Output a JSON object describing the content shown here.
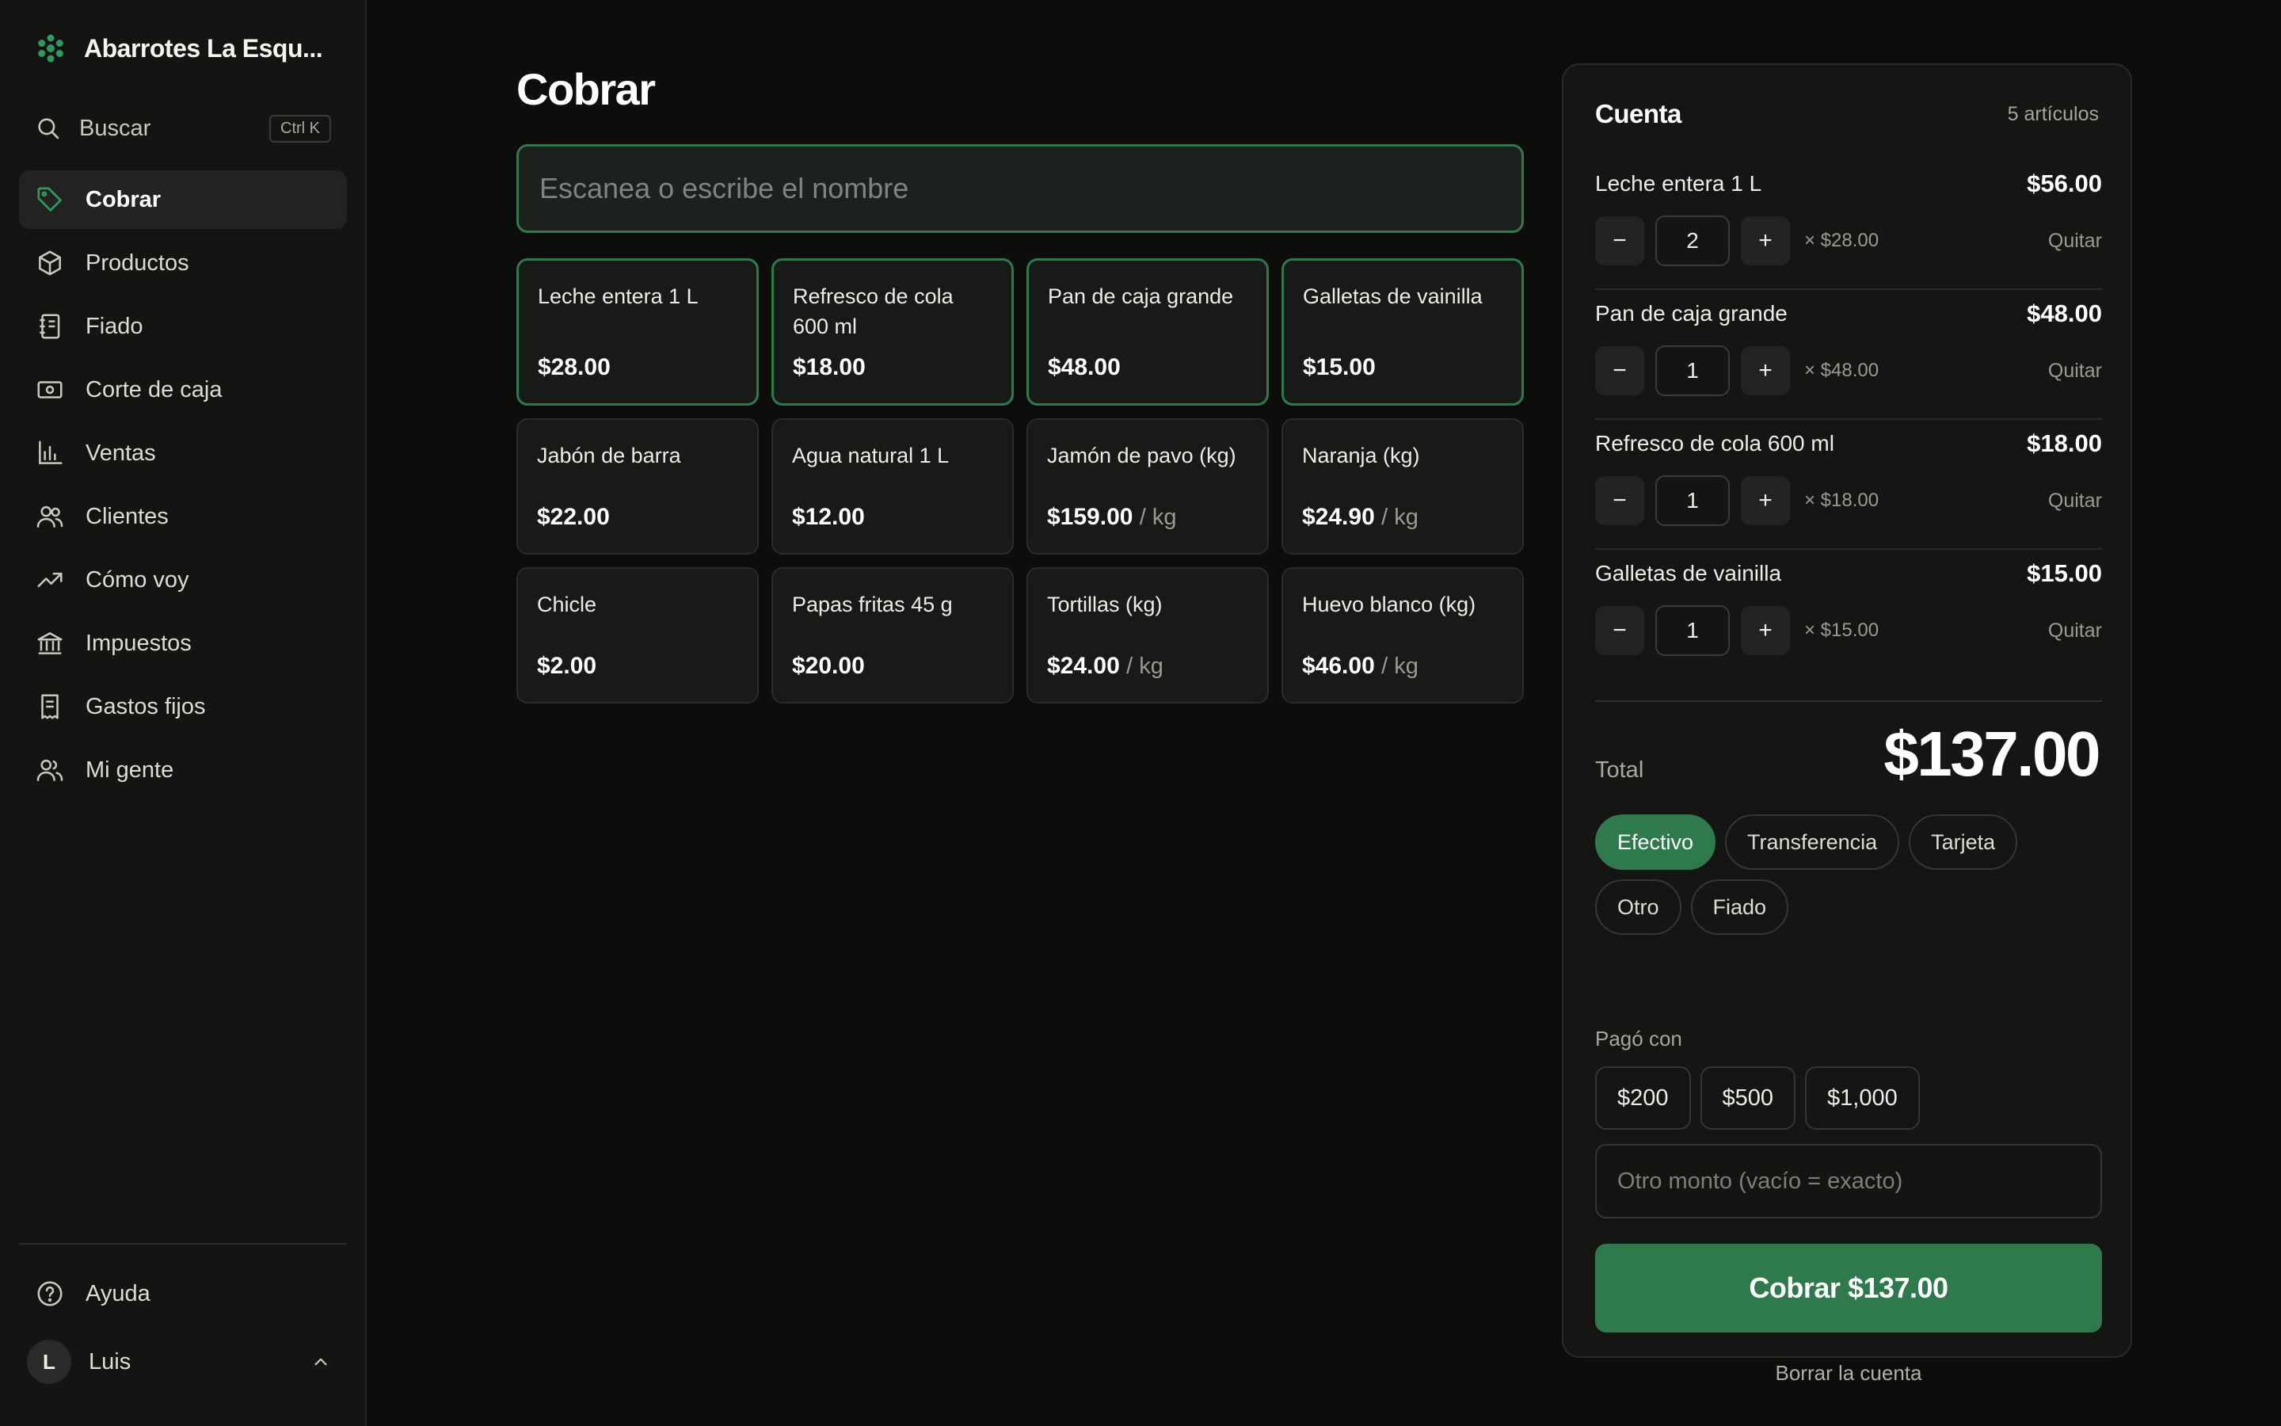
{
  "brand": {
    "name": "Abarrotes La Esqu..."
  },
  "search": {
    "label": "Buscar",
    "shortcut": "Ctrl K"
  },
  "nav": [
    {
      "label": "Cobrar",
      "icon": "tag-icon",
      "active": true
    },
    {
      "label": "Productos",
      "icon": "box-icon"
    },
    {
      "label": "Fiado",
      "icon": "notebook-icon"
    },
    {
      "label": "Corte de caja",
      "icon": "cash-icon"
    },
    {
      "label": "Ventas",
      "icon": "bar-chart-icon"
    },
    {
      "label": "Clientes",
      "icon": "users-icon"
    },
    {
      "label": "Cómo voy",
      "icon": "trend-up-icon"
    },
    {
      "label": "Impuestos",
      "icon": "bank-icon"
    },
    {
      "label": "Gastos fijos",
      "icon": "receipt-icon"
    },
    {
      "label": "Mi gente",
      "icon": "team-icon"
    }
  ],
  "help": {
    "label": "Ayuda"
  },
  "user": {
    "initial": "L",
    "name": "Luis"
  },
  "page": {
    "title": "Cobrar",
    "scan_placeholder": "Escanea o escribe el nombre"
  },
  "products": [
    {
      "name": "Leche entera 1 L",
      "price": "$28.00",
      "unit": "",
      "in_cart": true
    },
    {
      "name": "Refresco de cola 600 ml",
      "price": "$18.00",
      "unit": "",
      "in_cart": true
    },
    {
      "name": "Pan de caja grande",
      "price": "$48.00",
      "unit": "",
      "in_cart": true
    },
    {
      "name": "Galletas de vainilla",
      "price": "$15.00",
      "unit": "",
      "in_cart": true
    },
    {
      "name": "Jabón de barra",
      "price": "$22.00",
      "unit": ""
    },
    {
      "name": "Agua natural 1 L",
      "price": "$12.00",
      "unit": ""
    },
    {
      "name": "Jamón de pavo (kg)",
      "price": "$159.00",
      "unit": "/ kg"
    },
    {
      "name": "Naranja (kg)",
      "price": "$24.90",
      "unit": "/ kg"
    },
    {
      "name": "Chicle",
      "price": "$2.00",
      "unit": ""
    },
    {
      "name": "Papas fritas 45 g",
      "price": "$20.00",
      "unit": ""
    },
    {
      "name": "Tortillas (kg)",
      "price": "$24.00",
      "unit": "/ kg"
    },
    {
      "name": "Huevo blanco (kg)",
      "price": "$46.00",
      "unit": "/ kg"
    }
  ],
  "cart": {
    "title": "Cuenta",
    "count": "5 artículos",
    "lines": [
      {
        "name": "Leche entera 1 L",
        "total": "$56.00",
        "qty": "2",
        "unit_price": "× $28.00",
        "remove": "Quitar"
      },
      {
        "name": "Pan de caja grande",
        "total": "$48.00",
        "qty": "1",
        "unit_price": "× $48.00",
        "remove": "Quitar"
      },
      {
        "name": "Refresco de cola 600 ml",
        "total": "$18.00",
        "qty": "1",
        "unit_price": "× $18.00",
        "remove": "Quitar"
      },
      {
        "name": "Galletas de vainilla",
        "total": "$15.00",
        "qty": "1",
        "unit_price": "× $15.00",
        "remove": "Quitar"
      }
    ],
    "total_label": "Total",
    "total": "$137.00",
    "payment_methods": [
      {
        "label": "Efectivo",
        "active": true
      },
      {
        "label": "Transferencia"
      },
      {
        "label": "Tarjeta"
      },
      {
        "label": "Otro"
      },
      {
        "label": "Fiado"
      }
    ],
    "paid_with_label": "Pagó con",
    "quick_amounts": [
      "$200",
      "$500",
      "$1,000"
    ],
    "amount_placeholder": "Otro monto (vacío = exacto)",
    "charge_label": "Cobrar $137.00",
    "clear_label": "Borrar la cuenta"
  },
  "colors": {
    "accent": "#2f7a4c",
    "background": "#0d0d0c",
    "sidebar": "#141413",
    "panel": "#151514"
  }
}
